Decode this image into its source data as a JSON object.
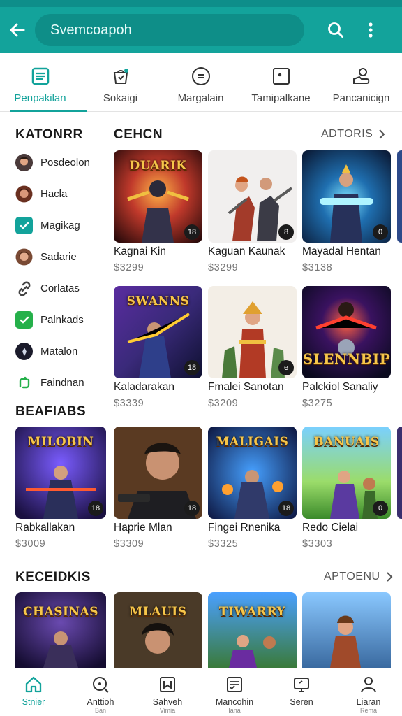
{
  "header": {
    "search_value": "Svemcoapoh"
  },
  "tabs": [
    {
      "label": "Penpakilan",
      "icon": "list-icon",
      "active": true
    },
    {
      "label": "Sokaigi",
      "icon": "bag-icon",
      "active": false
    },
    {
      "label": "Margalain",
      "icon": "circle-menu-icon",
      "active": false
    },
    {
      "label": "Tamipalkane",
      "icon": "dice-icon",
      "active": false
    },
    {
      "label": "Pancanicign",
      "icon": "user-hand-icon",
      "active": false
    }
  ],
  "categories": {
    "title": "KATONRR",
    "items": [
      {
        "label": "Posdeolon",
        "icon": "avatar-icon",
        "color": "#c98f6a"
      },
      {
        "label": "Hacla",
        "icon": "avatar-icon",
        "color": "#b9735a"
      },
      {
        "label": "Magikag",
        "icon": "check-icon",
        "color": "#13a39b"
      },
      {
        "label": "Sadarie",
        "icon": "avatar-icon",
        "color": "#a76a4e"
      },
      {
        "label": "Corlatas",
        "icon": "link-icon",
        "color": "#444444"
      },
      {
        "label": "Palnkads",
        "icon": "check-icon",
        "color": "#25b04a"
      },
      {
        "label": "Matalon",
        "icon": "emblem-icon",
        "color": "#1b1b2b"
      },
      {
        "label": "Faindnan",
        "icon": "refresh-icon",
        "color": "#25b04a"
      }
    ]
  },
  "featured": {
    "title": "CEHCN",
    "see_all": "ADTORIS",
    "cards": [
      {
        "name": "Kagnai Kin",
        "price": "$3299",
        "badge": "18",
        "art_title": "DUARIK"
      },
      {
        "name": "Kaguan Kaunak",
        "price": "$3299",
        "badge": "8",
        "art_title": ""
      },
      {
        "name": "Mayadal Hentan",
        "price": "$3138",
        "badge": "0",
        "art_title": ""
      },
      {
        "name": "Kaladarakan",
        "price": "$3339",
        "badge": "18",
        "art_title": "SWANNS"
      },
      {
        "name": "Fmalei Sanotan",
        "price": "$3209",
        "badge": "e",
        "art_title": ""
      },
      {
        "name": "Palckiol Sanaliy",
        "price": "$3275",
        "badge": "",
        "art_title": "SLENNBIP"
      }
    ]
  },
  "bestsellers": {
    "title": "BEAFIABS",
    "cards": [
      {
        "name": "Rabkallakan",
        "price": "$3009",
        "badge": "18",
        "art_title": "MILOBIN"
      },
      {
        "name": "Haprie Mlan",
        "price": "$3309",
        "badge": "18",
        "art_title": ""
      },
      {
        "name": "Fingei Rnenika",
        "price": "$3325",
        "badge": "18",
        "art_title": "MALIGAIS"
      },
      {
        "name": "Redo Cielai",
        "price": "$3303",
        "badge": "0",
        "art_title": "BANUAIS"
      }
    ]
  },
  "keceidkis": {
    "title": "KECEIDKIS",
    "see_all": "APTOENU",
    "cards": [
      {
        "art_title": "CHASINAS"
      },
      {
        "art_title": "MLAUIS"
      },
      {
        "art_title": "TIWARRY"
      },
      {
        "art_title": ""
      }
    ]
  },
  "bottom_nav": [
    {
      "label": "Stnier",
      "sub": "",
      "icon": "home-icon",
      "active": true
    },
    {
      "label": "Anttioh",
      "sub": "Ban",
      "icon": "search-icon",
      "active": false
    },
    {
      "label": "Sahveh",
      "sub": "Vimia",
      "icon": "book-icon",
      "active": false
    },
    {
      "label": "Mancohin",
      "sub": "Iana",
      "icon": "checklist-icon",
      "active": false
    },
    {
      "label": "Seren",
      "sub": "",
      "icon": "screen-icon",
      "active": false
    },
    {
      "label": "Liaran",
      "sub": "Rema",
      "icon": "profile-icon",
      "active": false
    }
  ],
  "colors": {
    "accent": "#13a39b",
    "accent_dark": "#0e8e88"
  }
}
